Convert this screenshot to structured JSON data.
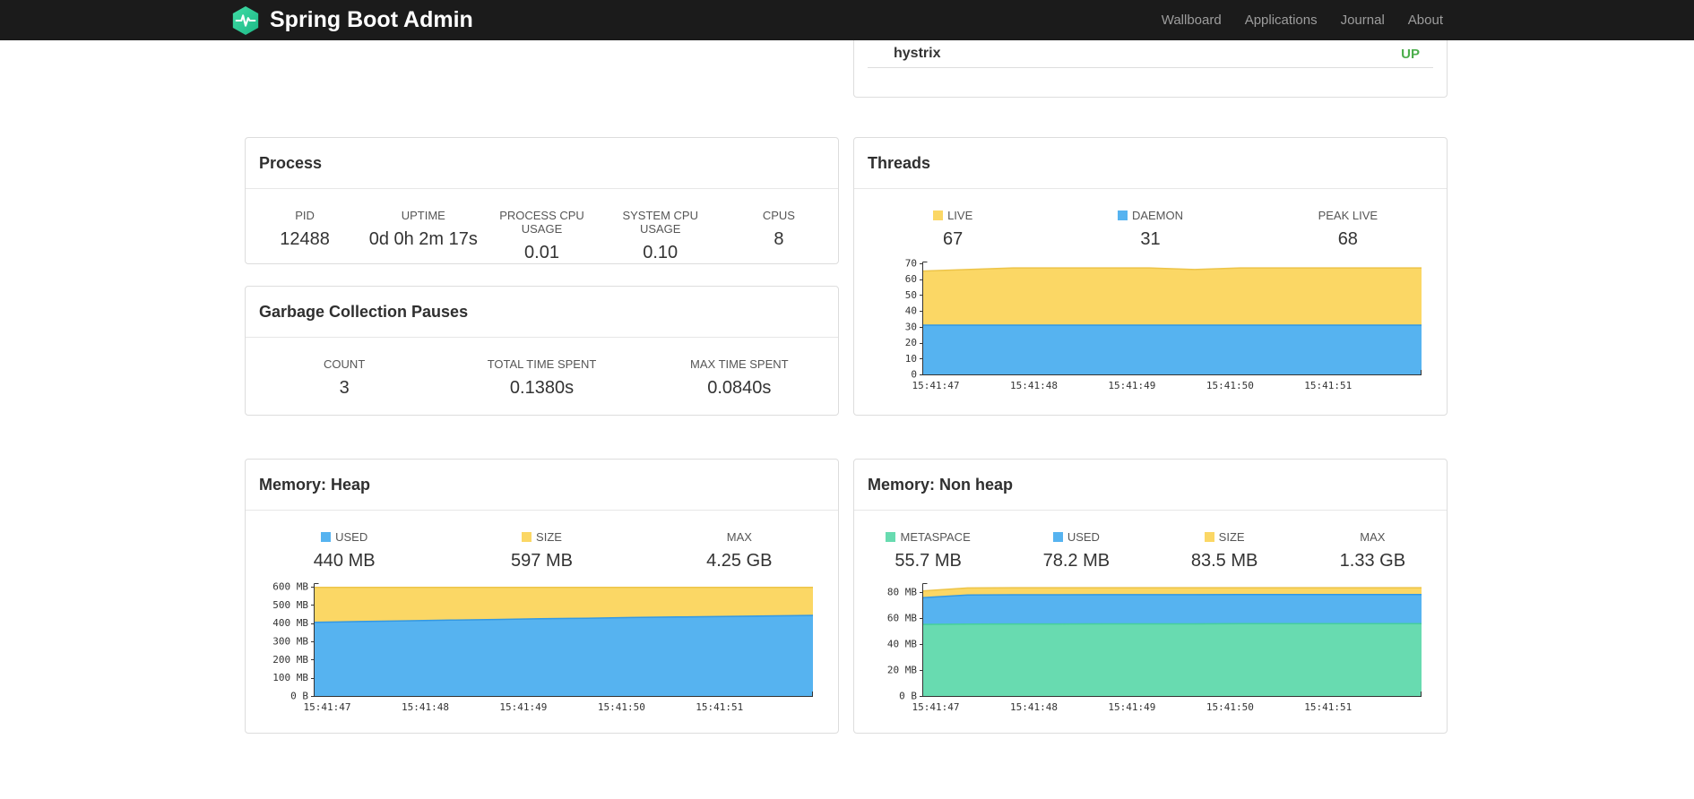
{
  "navbar": {
    "brand": "Spring Boot Admin",
    "items": [
      {
        "label": "Wallboard"
      },
      {
        "label": "Applications"
      },
      {
        "label": "Journal"
      },
      {
        "label": "About"
      }
    ]
  },
  "health": {
    "rows": [
      {
        "name": "hystrix",
        "status": "UP",
        "status_color": "#4cae4c"
      }
    ]
  },
  "panels": {
    "process": {
      "title": "Process",
      "stats": [
        {
          "label": "PID",
          "value": "12488"
        },
        {
          "label": "UPTIME",
          "value": "0d 0h 2m 17s"
        },
        {
          "label": "PROCESS CPU USAGE",
          "value": "0.01"
        },
        {
          "label": "SYSTEM CPU USAGE",
          "value": "0.10"
        },
        {
          "label": "CPUS",
          "value": "8"
        }
      ]
    },
    "gc": {
      "title": "Garbage Collection Pauses",
      "stats": [
        {
          "label": "COUNT",
          "value": "3"
        },
        {
          "label": "TOTAL TIME SPENT",
          "value": "0.1380s"
        },
        {
          "label": "MAX TIME SPENT",
          "value": "0.0840s"
        }
      ]
    },
    "threads": {
      "title": "Threads",
      "stats": [
        {
          "label": "LIVE",
          "value": "67",
          "color": "#fbd765"
        },
        {
          "label": "DAEMON",
          "value": "31",
          "color": "#56b3f0"
        },
        {
          "label": "PEAK LIVE",
          "value": "68"
        }
      ]
    },
    "heap": {
      "title": "Memory: Heap",
      "stats": [
        {
          "label": "USED",
          "value": "440 MB",
          "color": "#56b3f0"
        },
        {
          "label": "SIZE",
          "value": "597 MB",
          "color": "#fbd765"
        },
        {
          "label": "MAX",
          "value": "4.25 GB"
        }
      ]
    },
    "nonheap": {
      "title": "Memory: Non heap",
      "stats": [
        {
          "label": "METASPACE",
          "value": "55.7 MB",
          "color": "#68dbb0"
        },
        {
          "label": "USED",
          "value": "78.2 MB",
          "color": "#56b3f0"
        },
        {
          "label": "SIZE",
          "value": "83.5 MB",
          "color": "#fbd765"
        },
        {
          "label": "MAX",
          "value": "1.33 GB"
        }
      ]
    }
  },
  "chart_data": [
    {
      "id": "threads",
      "type": "area",
      "title": "Threads",
      "legend_position": "top",
      "x_labels": [
        "15:41:47",
        "15:41:48",
        "15:41:49",
        "15:41:50",
        "15:41:51"
      ],
      "ylim": [
        0,
        71
      ],
      "yticks": [
        0,
        10,
        20,
        30,
        40,
        50,
        60,
        70
      ],
      "ytick_labels": [
        "0",
        "10",
        "20",
        "30",
        "40",
        "50",
        "60",
        "70"
      ],
      "series": [
        {
          "name": "LIVE",
          "color": "#fbd765",
          "line": "#edc449",
          "values": [
            65,
            66,
            67,
            67,
            67,
            67,
            66,
            67,
            67,
            67,
            67,
            67
          ]
        },
        {
          "name": "DAEMON",
          "color": "#56b3f0",
          "line": "#3398e3",
          "values": [
            31,
            31,
            31,
            31,
            31,
            31,
            31,
            31,
            31,
            31,
            31,
            31
          ]
        }
      ]
    },
    {
      "id": "heap",
      "type": "area",
      "title": "Memory: Heap",
      "legend_position": "top",
      "x_labels": [
        "15:41:47",
        "15:41:48",
        "15:41:49",
        "15:41:50",
        "15:41:51"
      ],
      "ylim": [
        0,
        620
      ],
      "yticks": [
        0,
        100,
        200,
        300,
        400,
        500,
        600
      ],
      "ytick_labels": [
        "0 B",
        "100 MB",
        "200 MB",
        "300 MB",
        "400 MB",
        "500 MB",
        "600 MB"
      ],
      "series": [
        {
          "name": "SIZE",
          "color": "#fbd765",
          "line": "#edc449",
          "values": [
            597,
            597,
            597,
            597,
            597,
            597,
            597,
            597,
            597,
            597,
            597,
            597
          ]
        },
        {
          "name": "USED",
          "color": "#56b3f0",
          "line": "#3398e3",
          "values": [
            405,
            409,
            413,
            417,
            420,
            424,
            427,
            431,
            434,
            437,
            440,
            443
          ]
        }
      ]
    },
    {
      "id": "nonheap",
      "type": "area",
      "title": "Memory: Non heap",
      "legend_position": "top",
      "x_labels": [
        "15:41:47",
        "15:41:48",
        "15:41:49",
        "15:41:50",
        "15:41:51"
      ],
      "ylim": [
        0,
        87
      ],
      "yticks": [
        0,
        20,
        40,
        60,
        80
      ],
      "ytick_labels": [
        "0 B",
        "20 MB",
        "40 MB",
        "60 MB",
        "80 MB"
      ],
      "series": [
        {
          "name": "SIZE",
          "color": "#fbd765",
          "line": "#edc449",
          "values": [
            80.9,
            83.3,
            83.5,
            83.5,
            83.5,
            83.5,
            83.5,
            83.5,
            83.5,
            83.5,
            83.5,
            83.5
          ]
        },
        {
          "name": "USED",
          "color": "#56b3f0",
          "line": "#3398e3",
          "values": [
            75.8,
            77.8,
            78.0,
            78.0,
            78.1,
            78.1,
            78.1,
            78.2,
            78.2,
            78.2,
            78.2,
            78.2
          ]
        },
        {
          "name": "METASPACE",
          "color": "#68dbb0",
          "line": "#46cf9b",
          "values": [
            55.2,
            55.4,
            55.5,
            55.5,
            55.6,
            55.6,
            55.6,
            55.7,
            55.7,
            55.7,
            55.7,
            55.7
          ]
        }
      ]
    }
  ]
}
